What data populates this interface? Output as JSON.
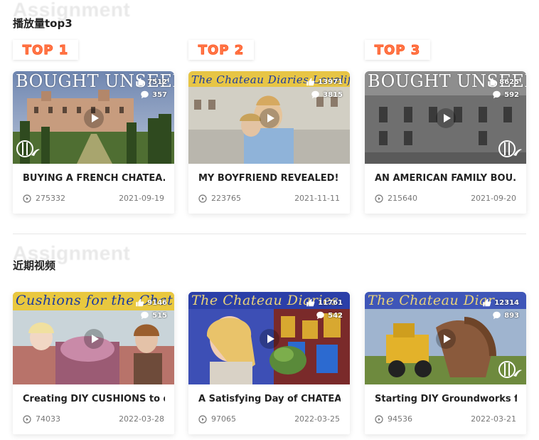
{
  "sections": [
    {
      "watermark": "Assignment",
      "title": "播放量top3",
      "cards": [
        {
          "badge": "TOP 1",
          "thumb_text": "BOUGHT UNSEEN",
          "likes": "7512",
          "comments": "357",
          "title": "BUYING A FRENCH CHATEA...",
          "views": "275332",
          "date": "2021-09-19"
        },
        {
          "badge": "TOP 2",
          "thumb_text": "The Chateau Diaries Lovelife & I",
          "likes": "13971",
          "comments": "3815",
          "title": "MY BOYFRIEND REVEALED!",
          "views": "223765",
          "date": "2021-11-11"
        },
        {
          "badge": "TOP 3",
          "thumb_text": "BOUGHT UNSEEN",
          "likes": "8625",
          "comments": "592",
          "title": "AN AMERICAN FAMILY BOU...",
          "views": "215640",
          "date": "2021-09-20"
        }
      ]
    },
    {
      "watermark": "Assignment",
      "title": "近期视频",
      "cards": [
        {
          "thumb_text": "Cushions for the Chat",
          "likes": "9146",
          "comments": "515",
          "title": "Creating DIY CUSHIONS to d...",
          "views": "74033",
          "date": "2022-03-28"
        },
        {
          "thumb_text": "The Chateau Diaries",
          "likes": "11761",
          "comments": "542",
          "title": "A Satisfying Day of CHATEA...",
          "views": "97065",
          "date": "2022-03-25"
        },
        {
          "thumb_text": "The Chateau Diar",
          "likes": "12314",
          "comments": "893",
          "title": "Starting DIY Groundworks fo...",
          "views": "94536",
          "date": "2022-03-21"
        }
      ]
    }
  ],
  "colors": {
    "badge_text": "#ff7a4a",
    "title_text": "#222222",
    "meta_text": "#777777"
  },
  "icons": [
    "thumbs-up-icon",
    "comment-icon",
    "play-icon",
    "play-circle-icon"
  ]
}
